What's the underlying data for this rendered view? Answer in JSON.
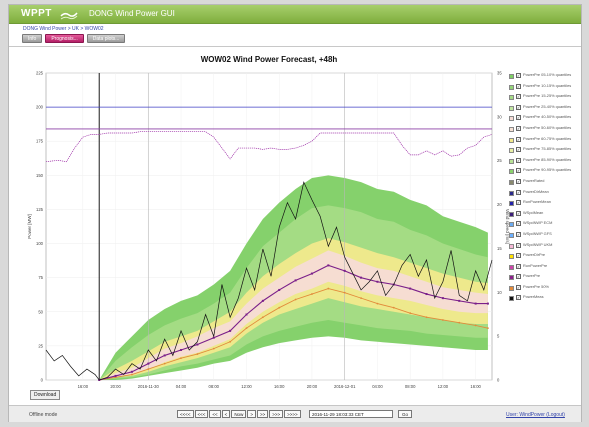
{
  "header": {
    "logo": "WPPT",
    "app_title": "DONG Wind Power GUI"
  },
  "breadcrumb": "DONG Wind Power > UK > WOW02",
  "toolbar": {
    "buttons": [
      {
        "label": "Info",
        "active": false
      },
      {
        "label": "Prognosis...",
        "active": true
      },
      {
        "label": "Data plots...",
        "active": false
      }
    ]
  },
  "chart_data": {
    "type": "area",
    "title": "WOW02 Wind Power Forecast, +48h",
    "ylabel": "Power [MW]",
    "y2label": "Wind speed [m/s]",
    "ylim": [
      0,
      225
    ],
    "y2lim": [
      0,
      35
    ],
    "yticks": [
      0,
      25,
      50,
      75,
      100,
      125,
      150,
      175,
      200,
      225
    ],
    "y2ticks": [
      0,
      5,
      10,
      15,
      20,
      25,
      30,
      35
    ],
    "xlim": [
      -4.5,
      50
    ],
    "xticks": [
      {
        "t": 0,
        "label": "16:00"
      },
      {
        "t": 4,
        "label": "20:00"
      },
      {
        "t": 8,
        "label": "2016-11-30"
      },
      {
        "t": 12,
        "label": "04:00"
      },
      {
        "t": 16,
        "label": "08:00"
      },
      {
        "t": 20,
        "label": "12:00"
      },
      {
        "t": 24,
        "label": "16:00"
      },
      {
        "t": 28,
        "label": "20:00"
      },
      {
        "t": 32,
        "label": "2016-12-01"
      },
      {
        "t": 36,
        "label": "04:00"
      },
      {
        "t": 40,
        "label": "08:00"
      },
      {
        "t": 44,
        "label": "12:00"
      },
      {
        "t": 48,
        "label": "16:00"
      }
    ],
    "now_t": 2,
    "day_lines_t": [
      8,
      32
    ],
    "forecast_t": [
      2,
      4,
      6,
      8,
      10,
      12,
      14,
      16,
      18,
      20,
      22,
      24,
      26,
      28,
      30,
      32,
      34,
      36,
      38,
      40,
      42,
      44,
      46,
      48,
      49.5
    ],
    "mean": [
      0,
      3,
      6,
      12,
      18,
      22,
      26,
      31,
      36,
      48,
      58,
      66,
      73,
      78,
      84,
      80,
      75,
      72,
      70,
      67,
      63,
      60,
      58,
      56,
      56
    ],
    "bands": [
      {
        "name": "PowerPre 05-10% quantiles",
        "color": "#7ecf64",
        "lower": [
          0,
          0,
          1,
          3,
          5,
          7,
          9,
          12,
          14,
          20,
          24,
          27,
          29,
          31,
          32,
          31,
          29,
          28,
          27,
          26,
          25,
          24,
          23,
          22,
          22
        ],
        "upper": [
          0,
          20,
          32,
          44,
          52,
          58,
          62,
          70,
          80,
          100,
          118,
          130,
          140,
          148,
          150,
          148,
          145,
          140,
          138,
          132,
          128,
          120,
          116,
          112,
          108
        ]
      },
      {
        "name": "PowerPre 10-15% quantiles",
        "color": "#a5dc86",
        "lower": [
          0,
          1,
          2,
          4,
          7,
          10,
          12,
          15,
          18,
          26,
          32,
          36,
          39,
          42,
          44,
          42,
          40,
          38,
          37,
          36,
          34,
          33,
          32,
          31,
          31
        ],
        "upper": [
          0,
          14,
          24,
          33,
          40,
          45,
          49,
          56,
          64,
          82,
          98,
          108,
          118,
          126,
          128,
          126,
          123,
          118,
          116,
          110,
          106,
          100,
          96,
          92,
          90
        ]
      },
      {
        "name": "PowerPre 25-75% quantiles",
        "color": "#f2e98c",
        "lower": [
          0,
          2,
          3,
          6,
          10,
          13,
          16,
          20,
          24,
          34,
          42,
          48,
          52,
          56,
          60,
          57,
          54,
          52,
          50,
          48,
          46,
          44,
          42,
          41,
          41
        ],
        "upper": [
          0,
          8,
          14,
          21,
          28,
          32,
          36,
          43,
          50,
          64,
          76,
          85,
          93,
          100,
          104,
          101,
          97,
          93,
          90,
          86,
          82,
          78,
          75,
          72,
          71
        ]
      },
      {
        "name": "PowerPre 40-60% quantiles",
        "color": "#f6dcd6",
        "lower": [
          0,
          2,
          4,
          8,
          13,
          17,
          20,
          25,
          30,
          41,
          50,
          57,
          63,
          67,
          72,
          69,
          65,
          62,
          60,
          58,
          55,
          52,
          50,
          49,
          49
        ],
        "upper": [
          0,
          5,
          9,
          16,
          23,
          27,
          32,
          38,
          43,
          56,
          67,
          75,
          83,
          89,
          95,
          91,
          86,
          82,
          80,
          76,
          72,
          68,
          66,
          64,
          63
        ]
      }
    ],
    "median_orange": [
      0,
      2,
      4,
      8,
      12,
      16,
      19,
      23,
      28,
      38,
      46,
      53,
      59,
      63,
      67,
      64,
      60,
      56,
      53,
      49,
      46,
      44,
      42,
      40,
      38
    ],
    "observed_t": [
      -4.5,
      -3.5,
      -2.5,
      -1.5,
      -0.5,
      0.5,
      1.5,
      2,
      3,
      4,
      5,
      6,
      7,
      8,
      9,
      10,
      11,
      12,
      13,
      14,
      15,
      16,
      17,
      18,
      19,
      20,
      21,
      22,
      23,
      24,
      25,
      26,
      27,
      28,
      29,
      30,
      31,
      32,
      33,
      34,
      35,
      36,
      37,
      38,
      39,
      40,
      41,
      42,
      43,
      44,
      45,
      46,
      47,
      48,
      49,
      50
    ],
    "observed": [
      22,
      14,
      18,
      10,
      3,
      8,
      4,
      0,
      2,
      8,
      4,
      12,
      8,
      22,
      14,
      30,
      18,
      36,
      22,
      28,
      48,
      32,
      70,
      46,
      60,
      82,
      66,
      96,
      76,
      112,
      130,
      118,
      145,
      132,
      120,
      98,
      112,
      90,
      78,
      66,
      72,
      80,
      62,
      70,
      84,
      92,
      76,
      88,
      60,
      72,
      95,
      62,
      58,
      80,
      66,
      88
    ],
    "wind_dir_t": [
      -4.5,
      -3,
      -2,
      -1,
      0,
      1,
      2,
      3,
      4,
      5,
      6,
      7,
      8,
      9,
      10,
      11,
      12,
      13,
      14,
      15,
      16,
      17,
      18,
      19,
      20,
      21,
      22,
      23,
      24,
      25,
      26,
      27,
      28,
      29,
      30,
      31,
      32,
      33,
      34,
      35,
      36,
      37,
      38,
      39,
      40,
      41,
      42,
      43,
      44,
      45,
      46,
      47,
      48,
      49,
      50
    ],
    "wind_dir": [
      160,
      161,
      160,
      170,
      178,
      180,
      180,
      181,
      181,
      181,
      181,
      182,
      182,
      182,
      182,
      182,
      182,
      182,
      182,
      182,
      178,
      170,
      162,
      170,
      170,
      170,
      169,
      170,
      169,
      169,
      170,
      172,
      175,
      181,
      181,
      181,
      181,
      181,
      181,
      181,
      181,
      181,
      181,
      172,
      165,
      165,
      168,
      165,
      168,
      164,
      165,
      170,
      172,
      178,
      180
    ],
    "hline_blue": 200,
    "hline_purple": 184
  },
  "legend": [
    {
      "label": "PowerPre 05-10% quantiles",
      "color": "#7ecf64"
    },
    {
      "label": "PowerPre 10-15% quantiles",
      "color": "#93d577"
    },
    {
      "label": "PowerPre 15-25% quantiles",
      "color": "#a5dc86"
    },
    {
      "label": "PowerPre 25-40% quantiles",
      "color": "#c2e7a2"
    },
    {
      "label": "PowerPre 40-50% quantiles",
      "color": "#f6dcd6"
    },
    {
      "label": "PowerPre 50-60% quantiles",
      "color": "#f6e2d6"
    },
    {
      "label": "PowerPre 60-75% quantiles",
      "color": "#f2e98c"
    },
    {
      "label": "PowerPre 75-85% quantiles",
      "color": "#e8f0a6"
    },
    {
      "label": "PowerPre 85-90% quantiles",
      "color": "#b8e296"
    },
    {
      "label": "PowerPre 90-95% quantiles",
      "color": "#8bd36e"
    },
    {
      "label": "PowerRated",
      "color": "#8a8a6e"
    },
    {
      "label": "PowerDirMean",
      "color": "#2a2a8a"
    },
    {
      "label": "RunPowerMean",
      "color": "#2222aa"
    },
    {
      "label": "WSpdMean",
      "color": "#3b1f7a"
    },
    {
      "label": "WSpdNWP ECM",
      "color": "#6aaaf0"
    },
    {
      "label": "WSpdNWP GFS",
      "color": "#6ab0ff"
    },
    {
      "label": "WSpdNWP UKM",
      "color": "#f6b8d6"
    },
    {
      "label": "PowerDirPre",
      "color": "#ffe100"
    },
    {
      "label": "RunPowerPre",
      "color": "#cc44aa"
    },
    {
      "label": "PowerPre",
      "color": "#8b1f8b"
    },
    {
      "label": "PowerPre 50%",
      "color": "#e28b3b"
    },
    {
      "label": "PowerMeas",
      "color": "#111111"
    }
  ],
  "download_label": "Download",
  "footer": {
    "offline": "Offline mode",
    "nav_buttons": [
      "<<<<",
      "<<<",
      "<<",
      "<",
      "Now",
      ">",
      ">>",
      ">>>",
      ">>>>"
    ],
    "date_value": "2016-11-29 18:03:33 CET",
    "go_label": "Go",
    "user_link": "User: WindPower (Logout)"
  },
  "colors": {
    "header": "#8fbd4f",
    "mean_line": "#7a1f8a",
    "median_line": "#e28b3b",
    "wind_dir_line": "#9c2ca6",
    "blue_line": "#3f3fc6"
  }
}
